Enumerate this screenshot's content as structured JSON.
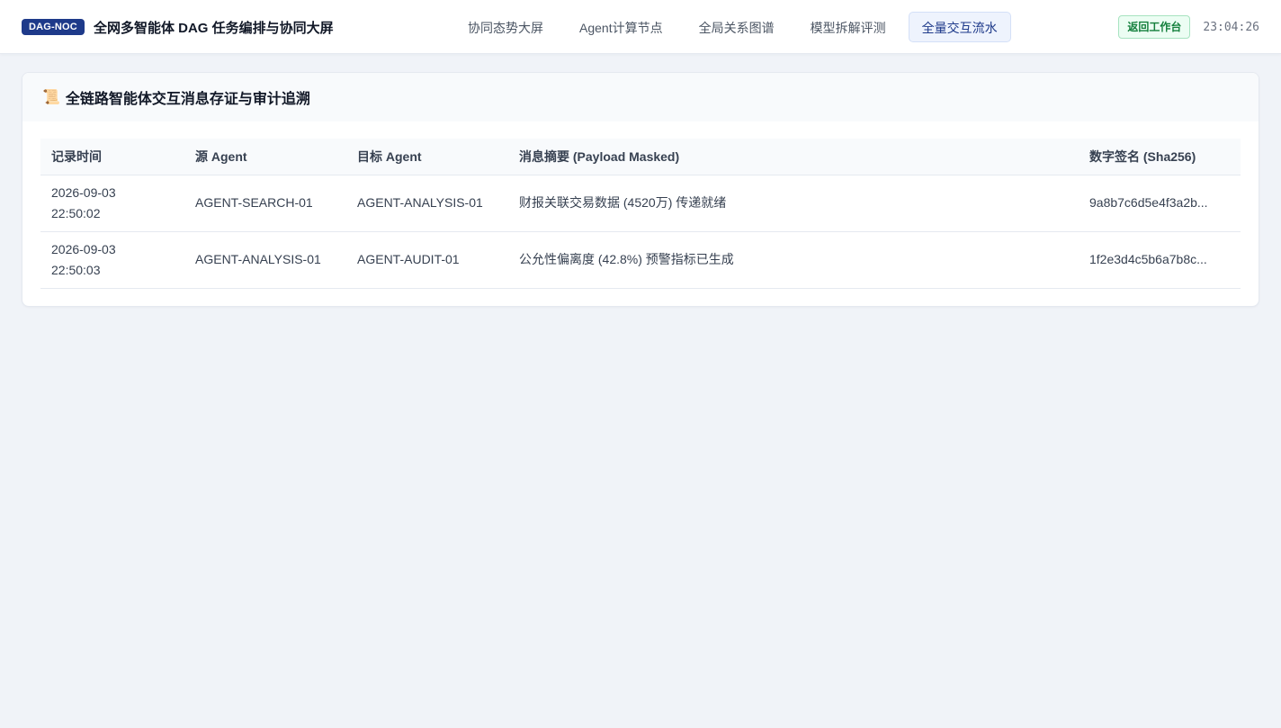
{
  "header": {
    "badge": "DAG-NOC",
    "title": "全网多智能体 DAG 任务编排与协同大屏",
    "tabs": [
      {
        "label": "协同态势大屏"
      },
      {
        "label": "Agent计算节点"
      },
      {
        "label": "全局关系图谱"
      },
      {
        "label": "模型拆解评测"
      },
      {
        "label": "全量交互流水"
      }
    ],
    "active_tab": "全量交互流水",
    "back_button": "返回工作台",
    "clock": "23:04:26"
  },
  "card": {
    "icon": "scroll-icon",
    "icon_glyph": "📜",
    "title": "全链路智能体交互消息存证与审计追溯",
    "columns": [
      "记录时间",
      "源 Agent",
      "目标 Agent",
      "消息摘要 (Payload Masked)",
      "数字签名 (Sha256)"
    ],
    "rows": [
      {
        "date": "2026-09-03",
        "time": "22:50:02",
        "source": "AGENT-SEARCH-01",
        "target": "AGENT-ANALYSIS-01",
        "summary": "财报关联交易数据 (4520万) 传递就绪",
        "signature": "9a8b7c6d5e4f3a2b..."
      },
      {
        "date": "2026-09-03",
        "time": "22:50:03",
        "source": "AGENT-ANALYSIS-01",
        "target": "AGENT-AUDIT-01",
        "summary": "公允性偏离度 (42.8%) 预警指标已生成",
        "signature": "1f2e3d4c5b6a7b8c..."
      }
    ]
  },
  "colors": {
    "badge_bg": "#1e3a8a",
    "active_tab_bg": "#eef3fd",
    "back_button_bg": "#ecfdf3",
    "back_button_text": "#15803d",
    "page_bg": "#f0f3f8"
  }
}
